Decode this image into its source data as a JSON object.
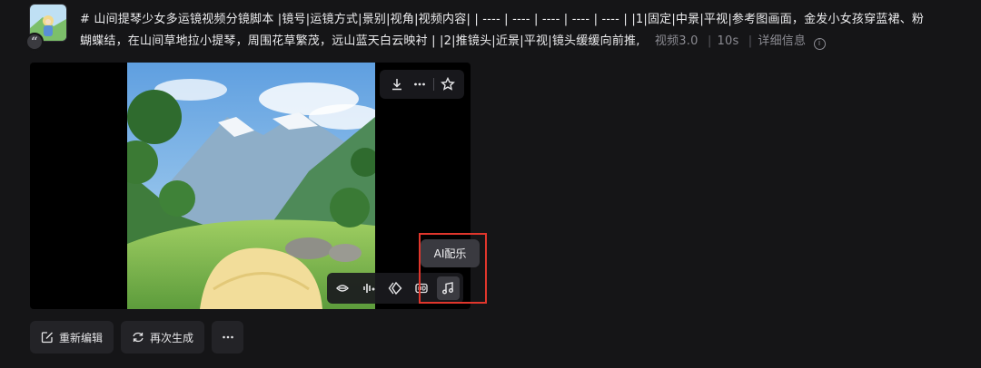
{
  "prompt": {
    "text": "# 山间提琴少女多运镜视频分镜脚本 |镜号|运镜方式|景别|视角|视频内容| | ---- | ---- | ---- | ---- | ---- | |1|固定|中景|平视|参考图画面，金发小女孩穿蓝裙、粉蝴蝶结，在山间草地拉小提琴，周围花草繁茂，远山蓝天白云映衬 | |2|推镜头|近景|平视|镜头缓缓向前推,",
    "model": "视频3.0",
    "duration": "10s",
    "details_label": "详细信息"
  },
  "player": {
    "top_actions": [
      "download-icon",
      "more-icon",
      "star-icon"
    ],
    "tools": [
      "lip-sync-icon",
      "audio-wave-icon",
      "frame-interp-icon",
      "hd-icon",
      "music-note-icon"
    ],
    "tooltip": "AI配乐"
  },
  "actions": {
    "reedit": "重新编辑",
    "regenerate": "再次生成"
  },
  "colors": {
    "background": "#151517",
    "highlight": "#e0362c"
  }
}
